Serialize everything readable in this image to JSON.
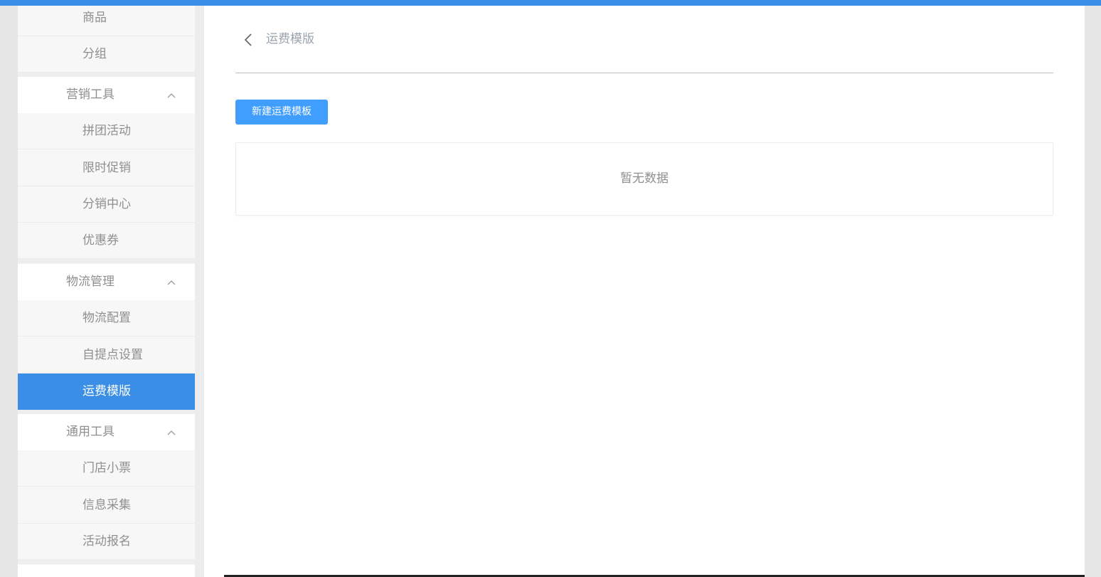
{
  "sidebar": {
    "items": [
      {
        "label": "商品",
        "type": "item"
      },
      {
        "label": "分组",
        "type": "item"
      },
      {
        "label": "营销工具",
        "type": "group"
      },
      {
        "label": "拼团活动",
        "type": "item"
      },
      {
        "label": "限时促销",
        "type": "item"
      },
      {
        "label": "分销中心",
        "type": "item"
      },
      {
        "label": "优惠券",
        "type": "item"
      },
      {
        "label": "物流管理",
        "type": "group"
      },
      {
        "label": "物流配置",
        "type": "item"
      },
      {
        "label": "自提点设置",
        "type": "item"
      },
      {
        "label": "运费模版",
        "type": "item",
        "active": true
      },
      {
        "label": "通用工具",
        "type": "group"
      },
      {
        "label": "门店小票",
        "type": "item"
      },
      {
        "label": "信息采集",
        "type": "item"
      },
      {
        "label": "活动报名",
        "type": "item"
      }
    ]
  },
  "header": {
    "title": "运费模版",
    "back_icon": "chevron-left-icon"
  },
  "toolbar": {
    "new_button_label": "新建运费模板"
  },
  "table": {
    "empty_text": "暂无数据"
  },
  "colors": {
    "accent": "#3a8ee6",
    "button": "#409eff",
    "text_muted": "#8f8f8f"
  }
}
